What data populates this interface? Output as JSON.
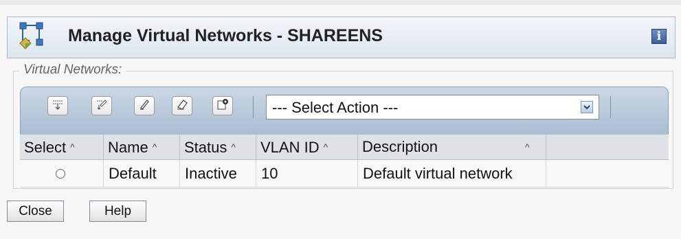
{
  "panel": {
    "title": "Manage Virtual Networks - SHAREENS",
    "icon": "network-topology-icon",
    "info_icon_glyph": "i"
  },
  "fieldset": {
    "legend": "Virtual Networks:"
  },
  "toolbar": {
    "buttons": [
      {
        "name": "create-network-icon"
      },
      {
        "name": "edit-network-icon"
      },
      {
        "name": "rename-icon"
      },
      {
        "name": "clear-icon"
      },
      {
        "name": "properties-icon"
      }
    ],
    "select_action": "--- Select Action ---"
  },
  "table": {
    "columns": [
      "Select",
      "Name",
      "Status",
      "VLAN ID",
      "Description"
    ],
    "sort_glyph": "^",
    "rows": [
      {
        "name": "Default",
        "status": "Inactive",
        "vlan_id": "10",
        "description": "Default virtual network"
      }
    ]
  },
  "buttons": {
    "close": "Close",
    "help": "Help"
  },
  "colors": {
    "header_bg": "#dfe3e8",
    "toolbar_bg": "#a9bdd1",
    "panel_border": "#a9b8c8"
  }
}
